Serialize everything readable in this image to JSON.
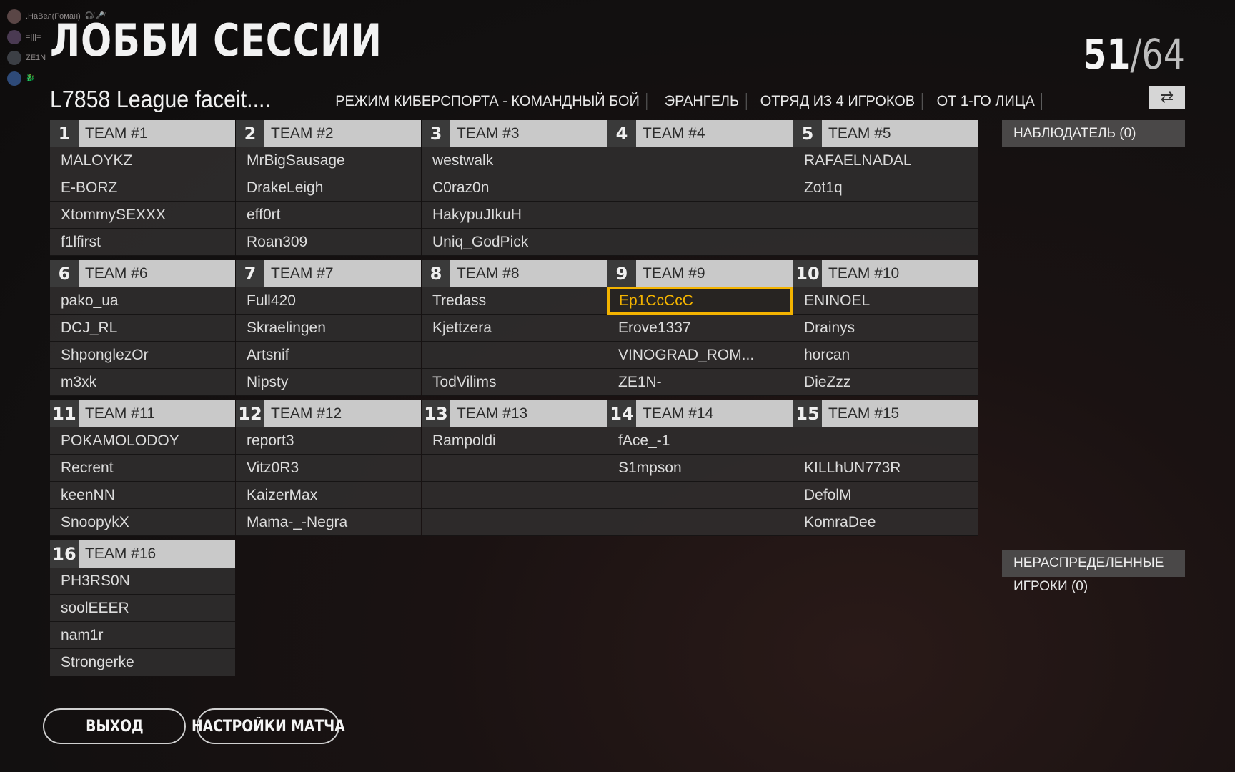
{
  "voice_overlay": [
    {
      "name": ".НаВел(Роман)",
      "icons": "🎧̸ 🎤̸"
    },
    {
      "name": "=|||=",
      "icons": ""
    },
    {
      "name": "ZE1N",
      "icons": ""
    },
    {
      "name": "",
      "icons": "🐉"
    }
  ],
  "header": {
    "title": "ЛОББИ СЕССИИ",
    "player_count": "51",
    "separator": "/",
    "max_players": "64",
    "session_name": "L7858 League faceit....",
    "modes": [
      "РЕЖИМ КИБЕРСПОРТА - КОМАНДНЫЙ БОЙ",
      "ЭРАНГЕЛЬ",
      "ОТРЯД ИЗ 4 ИГРОКОВ",
      "ОТ 1-ГО ЛИЦА"
    ],
    "swap_icon": "⇄"
  },
  "teams": [
    {
      "num": "1",
      "name": "TEAM #1",
      "players": [
        "MALOYKZ",
        "E-BORZ",
        "XtommySEXXX",
        "f1lfirst"
      ]
    },
    {
      "num": "2",
      "name": "TEAM #2",
      "players": [
        "MrBigSausage",
        "DrakeLeigh",
        "eff0rt",
        "Roan309"
      ]
    },
    {
      "num": "3",
      "name": "TEAM #3",
      "players": [
        "westwalk",
        "C0raz0n",
        "HakypuJIkuH",
        "Uniq_GodPick"
      ]
    },
    {
      "num": "4",
      "name": "TEAM #4",
      "players": [
        "",
        "",
        "",
        ""
      ]
    },
    {
      "num": "5",
      "name": "TEAM #5",
      "players": [
        "RAFAELNADAL",
        "Zot1q",
        "",
        ""
      ]
    },
    {
      "num": "6",
      "name": "TEAM #6",
      "players": [
        "pako_ua",
        "DCJ_RL",
        "ShponglezOr",
        "m3xk"
      ]
    },
    {
      "num": "7",
      "name": "TEAM #7",
      "players": [
        "Full420",
        "Skraelingen",
        "Artsnif",
        "Nipsty"
      ]
    },
    {
      "num": "8",
      "name": "TEAM #8",
      "players": [
        "Tredass",
        "Kjettzera",
        "",
        "TodVilims"
      ]
    },
    {
      "num": "9",
      "name": "TEAM #9",
      "players": [
        "Ep1CcCcC",
        "Erove1337",
        "VINOGRAD_ROM...",
        "ZE1N-"
      ]
    },
    {
      "num": "10",
      "name": "TEAM #10",
      "players": [
        "ENINOEL",
        "Drainys",
        "horcan",
        "DieZzz"
      ]
    },
    {
      "num": "11",
      "name": "TEAM #11",
      "players": [
        "POKAMOLODOY",
        "Recrent",
        "keenNN",
        "SnoopykX"
      ]
    },
    {
      "num": "12",
      "name": "TEAM #12",
      "players": [
        "report3",
        "Vitz0R3",
        "KaizerMax",
        "Mama-_-Negra"
      ]
    },
    {
      "num": "13",
      "name": "TEAM #13",
      "players": [
        "Rampoldi",
        "",
        "",
        ""
      ]
    },
    {
      "num": "14",
      "name": "TEAM #14",
      "players": [
        "fAce_-1",
        "S1mpson",
        "",
        ""
      ]
    },
    {
      "num": "15",
      "name": "TEAM #15",
      "players": [
        "",
        "KILLhUN773R",
        "DefolM",
        "KomraDee"
      ]
    },
    {
      "num": "16",
      "name": "TEAM #16",
      "players": [
        "PH3RS0N",
        "soolEEER",
        "nam1r",
        "Strongerke"
      ]
    }
  ],
  "selected_slot": {
    "team": 9,
    "slot": 1
  },
  "side_panel": {
    "observers": "НАБЛЮДАТЕЛЬ (0)",
    "unassigned_line1": "НЕРАСПРЕДЕЛЕННЫЕ",
    "unassigned_line2": "ИГРОКИ (0)"
  },
  "buttons": {
    "exit": "ВЫХОД",
    "match_settings": "НАСТРОЙКИ МАТЧА"
  },
  "colors": {
    "highlight": "#f3b300"
  }
}
